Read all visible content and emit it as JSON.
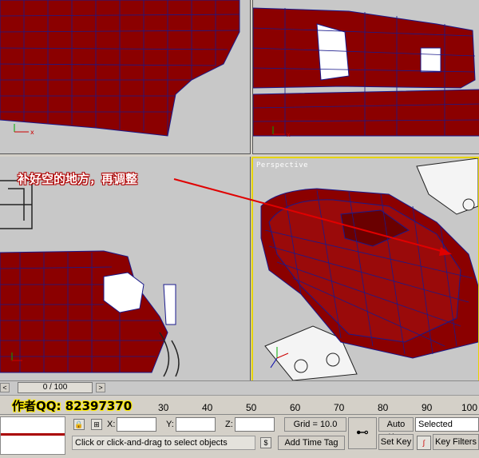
{
  "viewports": {
    "perspective_label": "Perspective"
  },
  "annotation": {
    "note_text": "补好空的地方，再调整"
  },
  "timeline": {
    "frame_display": "0 / 100",
    "prev_glyph": "<",
    "next_glyph": ">"
  },
  "ruler": {
    "ticks": [
      "30",
      "40",
      "50",
      "60",
      "70",
      "80",
      "90",
      "100"
    ]
  },
  "author": {
    "qq_text": "作者QQ: 82397370"
  },
  "status_bar": {
    "x_label": "X:",
    "y_label": "Y:",
    "z_label": "Z:",
    "grid_text": "Grid = 10.0",
    "auto_key": "Auto Key",
    "selected": "Selected",
    "set_key": "Set Key",
    "key_filters": "Key Filters",
    "prompt": "Click or click-and-drag to select objects",
    "add_time_tag": "Add Time Tag",
    "key_icon": "⊷"
  },
  "colors": {
    "mesh_red": "#8b0000",
    "wire_blue": "#1a1a8c",
    "viewport_bg": "#c8c8c8",
    "active_border": "#e6d400",
    "arrow_red": "#e00000"
  }
}
